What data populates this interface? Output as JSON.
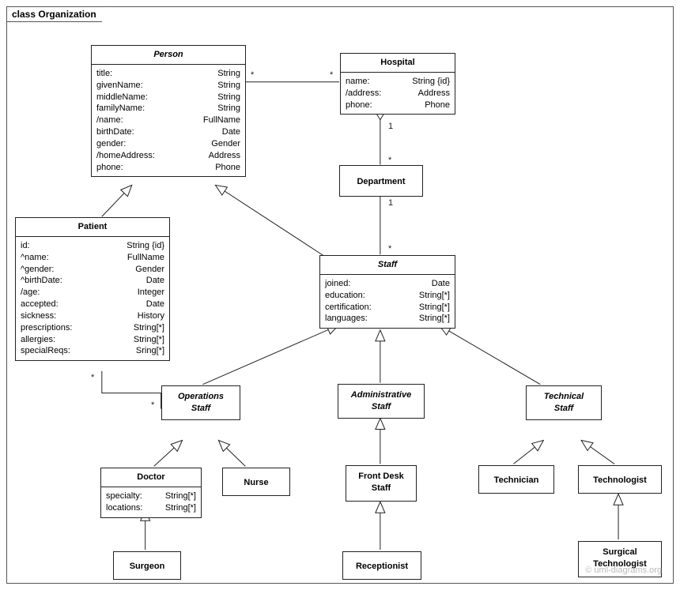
{
  "package": {
    "title": "class Organization"
  },
  "watermark": "© uml-diagrams.org",
  "classes": {
    "person": {
      "name": "Person",
      "attrs": [
        {
          "k": "title:",
          "v": "String"
        },
        {
          "k": "givenName:",
          "v": "String"
        },
        {
          "k": "middleName:",
          "v": "String"
        },
        {
          "k": "familyName:",
          "v": "String"
        },
        {
          "k": "/name:",
          "v": "FullName"
        },
        {
          "k": "birthDate:",
          "v": "Date"
        },
        {
          "k": "gender:",
          "v": "Gender"
        },
        {
          "k": "/homeAddress:",
          "v": "Address"
        },
        {
          "k": "phone:",
          "v": "Phone"
        }
      ]
    },
    "hospital": {
      "name": "Hospital",
      "attrs": [
        {
          "k": "name:",
          "v": "String {id}"
        },
        {
          "k": "/address:",
          "v": "Address"
        },
        {
          "k": "phone:",
          "v": "Phone"
        }
      ]
    },
    "department": {
      "name": "Department"
    },
    "patient": {
      "name": "Patient",
      "attrs": [
        {
          "k": "id:",
          "v": "String {id}"
        },
        {
          "k": "^name:",
          "v": "FullName"
        },
        {
          "k": "^gender:",
          "v": "Gender"
        },
        {
          "k": "^birthDate:",
          "v": "Date"
        },
        {
          "k": "/age:",
          "v": "Integer"
        },
        {
          "k": "accepted:",
          "v": "Date"
        },
        {
          "k": "sickness:",
          "v": "History"
        },
        {
          "k": "prescriptions:",
          "v": "String[*]"
        },
        {
          "k": "allergies:",
          "v": "String[*]"
        },
        {
          "k": "specialReqs:",
          "v": "Sring[*]"
        }
      ]
    },
    "staff": {
      "name": "Staff",
      "attrs": [
        {
          "k": "joined:",
          "v": "Date"
        },
        {
          "k": "education:",
          "v": "String[*]"
        },
        {
          "k": "certification:",
          "v": "String[*]"
        },
        {
          "k": "languages:",
          "v": "String[*]"
        }
      ]
    },
    "opsStaff": {
      "name": "Operations",
      "sub": "Staff"
    },
    "adminStaff": {
      "name": "Administrative",
      "sub": "Staff"
    },
    "techStaff": {
      "name": "Technical",
      "sub": "Staff"
    },
    "doctor": {
      "name": "Doctor",
      "attrs": [
        {
          "k": "specialty:",
          "v": "String[*]"
        },
        {
          "k": "locations:",
          "v": "String[*]"
        }
      ]
    },
    "nurse": {
      "name": "Nurse"
    },
    "frontDesk": {
      "name": "Front Desk",
      "sub": "Staff"
    },
    "technician": {
      "name": "Technician"
    },
    "technologist": {
      "name": "Technologist"
    },
    "surgeon": {
      "name": "Surgeon"
    },
    "receptionist": {
      "name": "Receptionist"
    },
    "surgTech": {
      "name": "Surgical",
      "sub": "Technologist"
    }
  },
  "mult": {
    "person_hospital_left": "*",
    "person_hospital_right": "*",
    "hospital_dept_top": "1",
    "hospital_dept_bottom": "*",
    "dept_staff_top": "1",
    "dept_staff_bottom": "*",
    "patient_ops_left": "*",
    "patient_ops_right": "*"
  }
}
